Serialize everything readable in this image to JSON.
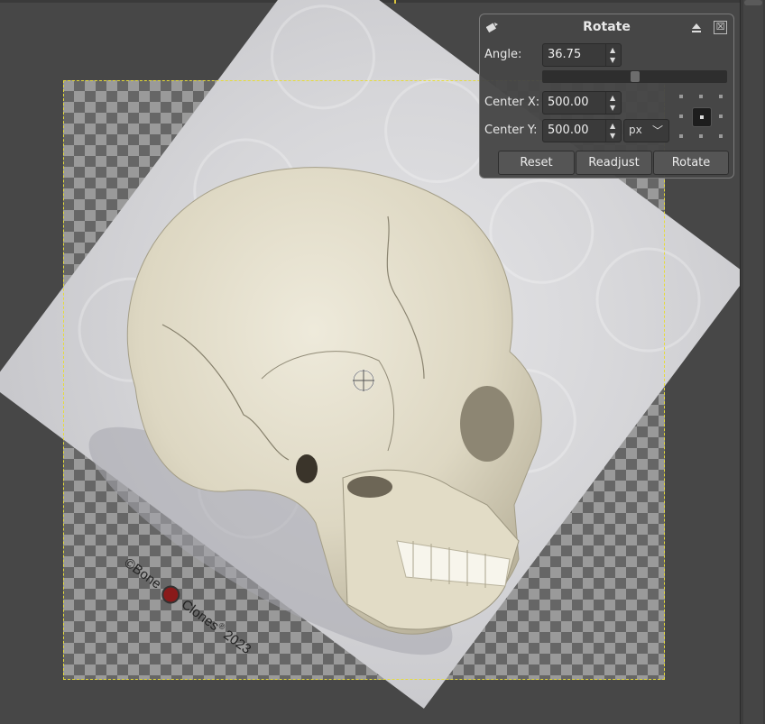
{
  "dialog": {
    "title": "Rotate",
    "icons": {
      "tool": "rotate-tool-icon",
      "collapse": "collapse-up-icon",
      "close": "close-icon"
    },
    "close_glyph": "☒",
    "angle": {
      "label": "Angle:",
      "value": "36.75",
      "slider_fraction": 0.5
    },
    "center_x": {
      "label": "Center X:",
      "value": "500.00"
    },
    "center_y": {
      "label": "Center Y:",
      "value": "500.00"
    },
    "unit": {
      "selected": "px"
    },
    "buttons": {
      "reset": "Reset",
      "readjust": "Readjust",
      "rotate": "Rotate"
    }
  },
  "canvas": {
    "watermark": {
      "prefix": "©",
      "brand_a": "Bone",
      "brand_b": "Clones",
      "registered": "®",
      "year": "2023"
    }
  },
  "colors": {
    "selection_dash": "#e6dc3a",
    "dialog_bg": "#464646",
    "canvas_bg": "#474747"
  }
}
